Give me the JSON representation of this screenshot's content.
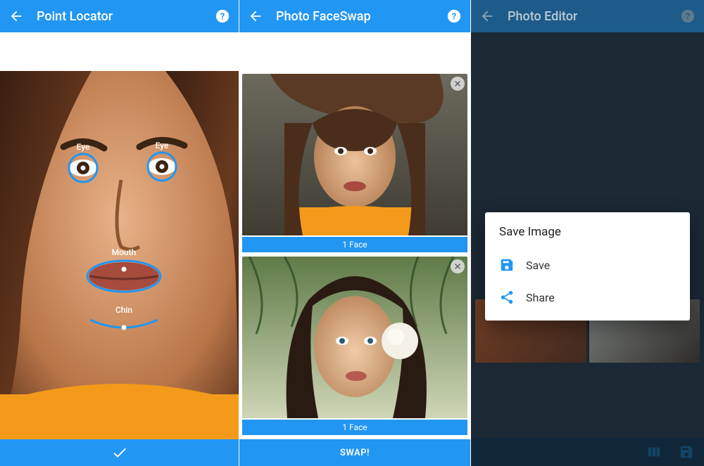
{
  "colors": {
    "accent": "#2196F3"
  },
  "left": {
    "title": "Point Locator",
    "markers": {
      "eye_left": "Eye",
      "eye_right": "Eye",
      "mouth": "Mouth",
      "chin": "Chin"
    }
  },
  "mid": {
    "title": "Photo FaceSwap",
    "cards": [
      {
        "caption": "1 Face"
      },
      {
        "caption": "1 Face"
      }
    ],
    "swap_button": "SWAP!"
  },
  "right": {
    "title": "Photo Editor",
    "dialog": {
      "title": "Save Image",
      "actions": [
        {
          "icon": "save-icon",
          "label": "Save"
        },
        {
          "icon": "share-icon",
          "label": "Share"
        }
      ]
    }
  }
}
